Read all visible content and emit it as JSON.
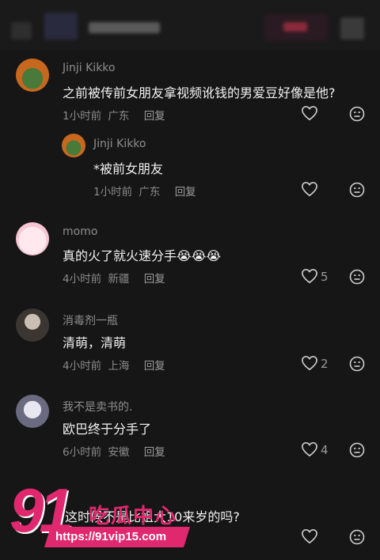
{
  "comments": [
    {
      "user": "Jinji Kikko",
      "text": "之前被传前女朋友拿视频讹钱的男爱豆好像是他?",
      "time": "1小时前",
      "location": "广东",
      "reply": "回复",
      "likes": ""
    },
    {
      "user": "Jinji Kikko",
      "text": "*被前女朋友",
      "time": "1小时前",
      "location": "广东",
      "reply": "回复",
      "likes": ""
    },
    {
      "user": "momo",
      "text": "真的火了就火速分手",
      "emoji": "😭😭😭",
      "time": "4小时前",
      "location": "新疆",
      "reply": "回复",
      "likes": "5"
    },
    {
      "user": "消毒剂一瓶",
      "text": "清萌，清萌",
      "time": "4小时前",
      "location": "上海",
      "reply": "回复",
      "likes": "2"
    },
    {
      "user": "我不是卖书的.",
      "text": "欧巴终于分手了",
      "time": "6小时前",
      "location": "安徽",
      "reply": "回复",
      "likes": "4"
    },
    {
      "user": "",
      "text": "这时候不是比姐大10来岁的吗?",
      "time": "",
      "location": "",
      "reply": "",
      "likes": ""
    }
  ],
  "watermark": {
    "number": "91",
    "label": "吃瓜中心",
    "url": "https://91vip15.com"
  },
  "colors": {
    "background": "#161616",
    "watermark": "#e0286e",
    "muted": "#8a8a8a"
  },
  "icons": [
    "heart-icon",
    "dislike-face-icon"
  ]
}
